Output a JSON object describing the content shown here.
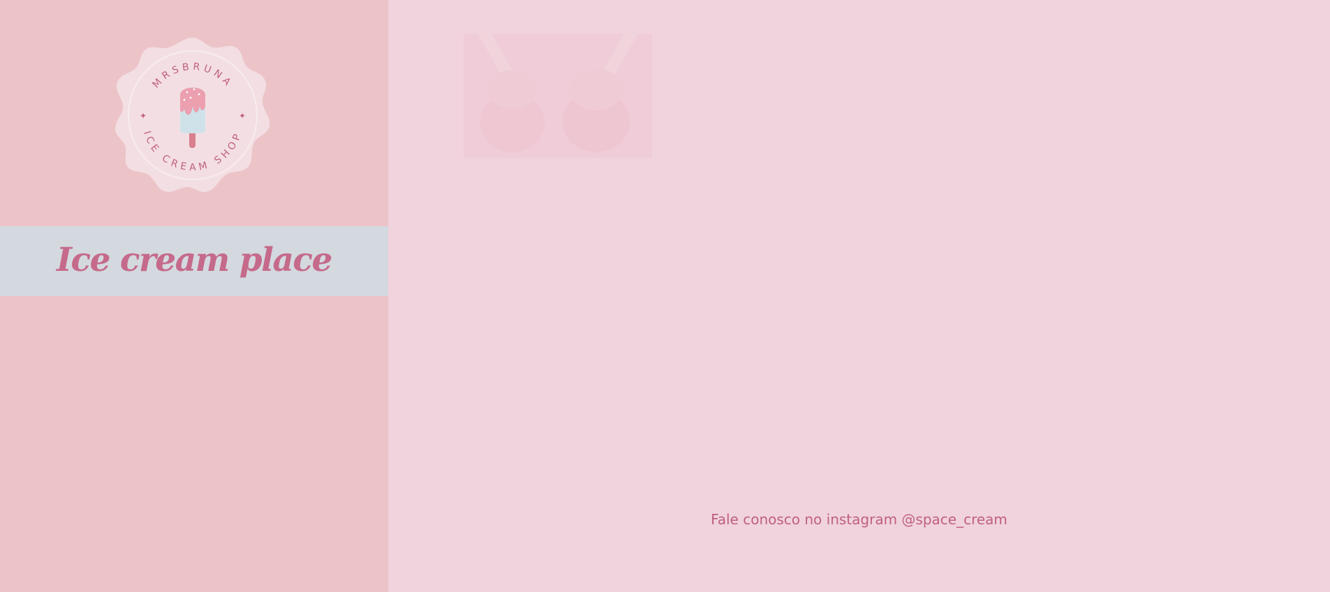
{
  "brand": {
    "logo_top_text": "MRSBRUNA",
    "logo_bottom_text": "ICE CREAM SHOP",
    "title": "Ice cream place"
  },
  "main": {
    "photo_icon": "ice-cream-photo",
    "footer_text": "Fale conosco no instagram @space_cream"
  },
  "colors": {
    "sidebar_bg": "#ecc4c8",
    "title_band_bg": "#d4d8df",
    "main_bg": "#f0d3dd",
    "accent": "#c56a8a"
  }
}
